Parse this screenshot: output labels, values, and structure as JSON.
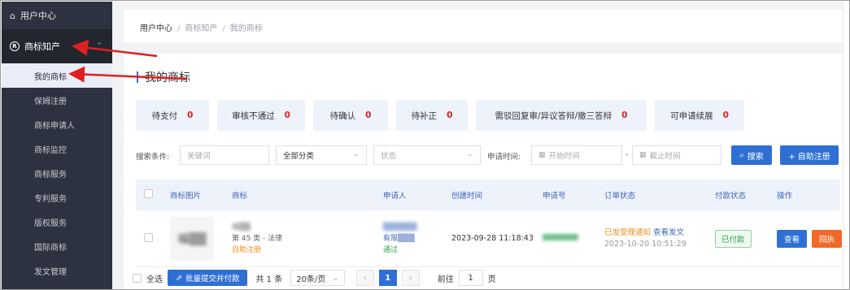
{
  "sidebar": {
    "user_center": "用户中心",
    "group": "商标知产",
    "items": [
      "我的商标",
      "保姆注册",
      "商标申请人",
      "商标监控",
      "商标服务",
      "专利服务",
      "版权服务",
      "国际商标",
      "发文管理"
    ]
  },
  "breadcrumb": [
    "用户中心",
    "商标知产",
    "我的商标"
  ],
  "page_title": "我的商标",
  "status_cards": [
    {
      "label": "待支付",
      "count": "0"
    },
    {
      "label": "审核不通过",
      "count": "0"
    },
    {
      "label": "待确认",
      "count": "0"
    },
    {
      "label": "待补正",
      "count": "0"
    },
    {
      "label": "需驳回复审/异议答辩/撤三答辩",
      "count": "0"
    },
    {
      "label": "可申请续展",
      "count": "0"
    }
  ],
  "filter": {
    "label": "搜索条件:",
    "keyword_placeholder": "关键词",
    "category_value": "全部分类",
    "status_placeholder": "状态",
    "date_label": "申请时间:",
    "start_placeholder": "开始时间",
    "dash": "-",
    "end_placeholder": "截止时间",
    "search_label": "搜索",
    "register_label": "+ 自助注册"
  },
  "table": {
    "headers": [
      "商标图片",
      "商标",
      "申请人",
      "创建时间",
      "申请号",
      "订单状态",
      "付款状态",
      "操作"
    ],
    "row": {
      "image_text": "福▒▒",
      "tm_name": "福▒▒",
      "tm_class": "第 45 类 - 法律",
      "tm_type": "自助注册",
      "applicant_line1": "▒▒▒▒▒▒",
      "applicant_line2": "有限▒▒▒",
      "applicant_status": "通过",
      "created": "2023-09-28 11:18:43",
      "order_status": "已发受理通知",
      "order_link": "查看发文",
      "order_time": "2023-10-20 10:51:29",
      "pay_status": "已付款",
      "btn_view": "查看",
      "btn_receipt": "回执"
    }
  },
  "footer": {
    "select_all": "全选",
    "batch_btn": "批量提交并付款",
    "total": "共 1 条",
    "page_size": "20条/页",
    "current_page": "1",
    "goto": "前往",
    "goto_value": "1",
    "page_suffix": "页"
  },
  "colors": {
    "sidebar_bg": "#2c3240",
    "primary": "#2f6fd4",
    "count_red": "#e02020",
    "orange": "#f06a2a",
    "arrow": "#e02020"
  }
}
